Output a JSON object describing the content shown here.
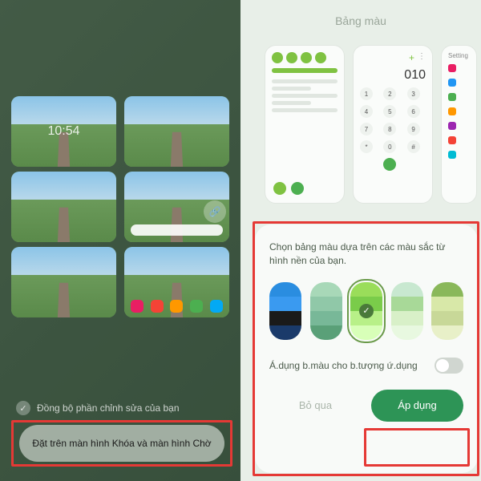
{
  "left": {
    "clock": "10:54",
    "sync_label": "Đồng bộ phần chỉnh sửa của bạn",
    "set_button": "Đặt trên màn hình Khóa và màn hình Chờ",
    "app_colors": [
      "#e91e63",
      "#f44336",
      "#ff9800",
      "#4caf50",
      "#03a9f4",
      "#9c27b0"
    ],
    "dock_colors": [
      "#2196f3",
      "#ff5722",
      "#4caf50",
      "#8bc34a",
      "#00bcd4"
    ]
  },
  "right": {
    "title": "Bảng màu",
    "dial_number": "010",
    "sheet_text": "Chọn bảng màu dựa trên các màu sắc từ hình nền của bạn.",
    "toggle_label": "Á.dụng b.màu cho b.tượng ứ.dụng",
    "skip": "Bỏ qua",
    "apply": "Áp dụng",
    "palettes": [
      {
        "colors": [
          "#2a8de0",
          "#3a9af0",
          "#1a1a1a",
          "#1a3a6a"
        ],
        "selected": false
      },
      {
        "colors": [
          "#a8d8b8",
          "#90c8a8",
          "#78b898",
          "#5aa078"
        ],
        "selected": false
      },
      {
        "colors": [
          "#9add5a",
          "#7acc4a",
          "#b8f088",
          "#d8ffb8"
        ],
        "selected": true
      },
      {
        "colors": [
          "#c8e8d0",
          "#a8d998",
          "#d8f0c8",
          "#e8f8e0"
        ],
        "selected": false
      },
      {
        "colors": [
          "#8ab85a",
          "#d8e8a8",
          "#c8d898",
          "#e8f0c8"
        ],
        "selected": false
      }
    ]
  }
}
